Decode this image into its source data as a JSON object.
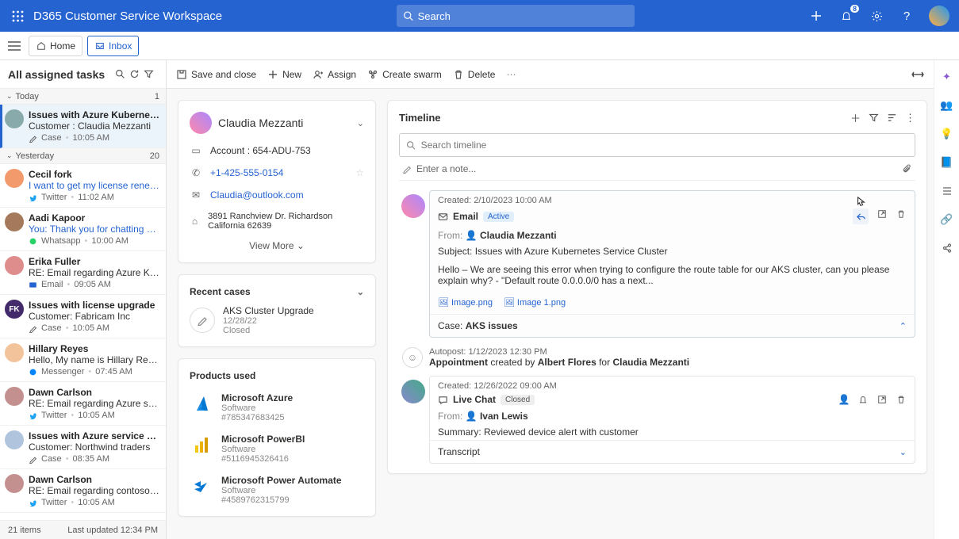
{
  "app_title": "D365 Customer Service Workspace",
  "search_placeholder": "Search",
  "notifications_count": "8",
  "tabs": {
    "home": "Home",
    "inbox": "Inbox"
  },
  "tasklist": {
    "title": "All assigned tasks",
    "groups": [
      {
        "label": "Today",
        "count": "1"
      },
      {
        "label": "Yesterday",
        "count": "20"
      }
    ],
    "items": [
      {
        "avatar_bg": "#8aa",
        "title": "Issues with Azure Kubernetes Service Cluster",
        "line": "Customer : Claudia Mezzanti",
        "channel": "Case",
        "channel_color": "#5c5c5c",
        "icon": "pencil",
        "time": "10:05 AM",
        "selected": true,
        "link": false
      },
      {
        "avatar_bg": "#f29a6b",
        "title": "Cecil fork",
        "line": "I want to get my license renewed by ...",
        "channel": "Twitter",
        "channel_color": "#1da1f2",
        "icon": "twitter",
        "time": "11:02 AM",
        "link": true
      },
      {
        "avatar_bg": "#a5795b",
        "title": "Aadi Kapoor",
        "line": "You: Thank you for chatting with mu...",
        "channel": "Whatsapp",
        "channel_color": "#25d366",
        "icon": "whatsapp",
        "time": "10:00 AM",
        "link": true
      },
      {
        "avatar_bg": "#de8c8c",
        "title": "Erika Fuller",
        "line": "RE: Email regarding Azure Kubernetes",
        "channel": "Email",
        "channel_color": "#2563d1",
        "icon": "email",
        "time": "09:05 AM",
        "link": false
      },
      {
        "avatar_bg": "#432a6b",
        "title": "Issues with license upgrade",
        "line": "Customer: Fabricam Inc",
        "channel": "Case",
        "channel_color": "#5c5c5c",
        "icon": "pencil",
        "time": "10:05 AM",
        "link": false,
        "initials": "FK"
      },
      {
        "avatar_bg": "#f3c49c",
        "title": "Hillary Reyes",
        "line": "Hello, My name is Hillary Reyes and...",
        "channel": "Messenger",
        "channel_color": "#0084ff",
        "icon": "messenger",
        "time": "07:45 AM",
        "link": false
      },
      {
        "avatar_bg": "#c48f8f",
        "title": "Dawn Carlson",
        "line": "RE: Email regarding Azure service errors",
        "channel": "Twitter",
        "channel_color": "#1da1f2",
        "icon": "twitter",
        "time": "10:05 AM",
        "link": false
      },
      {
        "avatar_bg": "#b0c4de",
        "title": "Issues with Azure service errors",
        "line": "Customer: Northwind traders",
        "channel": "Case",
        "channel_color": "#5c5c5c",
        "icon": "pencil",
        "time": "08:35 AM",
        "link": false
      },
      {
        "avatar_bg": "#c48f8f",
        "title": "Dawn Carlson",
        "line": "RE: Email regarding contoso machines",
        "channel": "Twitter",
        "channel_color": "#1da1f2",
        "icon": "twitter",
        "time": "10:05 AM",
        "link": false
      }
    ],
    "footer_items": "21 items",
    "footer_updated": "Last updated 12:34 PM"
  },
  "commands": {
    "save_close": "Save and close",
    "new": "New",
    "assign": "Assign",
    "swarm": "Create swarm",
    "delete": "Delete"
  },
  "customer": {
    "name": "Claudia Mezzanti",
    "account": "Account : 654-ADU-753",
    "phone": "+1-425-555-0154",
    "email": "Claudia@outlook.com",
    "address": "3891 Ranchview Dr. Richardson California 62639",
    "view_more": "View More"
  },
  "recent_cases": {
    "title": "Recent cases",
    "items": [
      {
        "title": "AKS Cluster Upgrade",
        "date": "12/28/22",
        "status": "Closed"
      }
    ]
  },
  "products": {
    "title": "Products used",
    "items": [
      {
        "name": "Microsoft Azure",
        "type": "Software",
        "serial": "#785347683425",
        "logo": "azure"
      },
      {
        "name": "Microsoft PowerBI",
        "type": "Software",
        "serial": "#5116945326416",
        "logo": "powerbi"
      },
      {
        "name": "Microsoft Power Automate",
        "type": "Software",
        "serial": "#4589762315799",
        "logo": "automate"
      }
    ]
  },
  "timeline": {
    "title": "Timeline",
    "search_ph": "Search timeline",
    "note_ph": "Enter a note...",
    "items": [
      {
        "created": "Created: 2/10/2023 10:00 AM",
        "type": "Email",
        "status": "Active",
        "from": "Claudia Mezzanti",
        "subject": "Subject: Issues with Azure Kubernetes Service Cluster",
        "body": "Hello – We are seeing this error when trying to configure the route table for our AKS cluster, can you please explain why? - \"Default route 0.0.0.0/0 has a next...",
        "attachments": [
          "Image.png",
          "Image 1.png"
        ],
        "footer": "Case: AKS issues",
        "hover": true
      },
      {
        "created": "Created: 12/26/2022 09:00 AM",
        "type": "Live Chat",
        "status": "Closed",
        "from": "Ivan Lewis",
        "summary": "Summary: Reviewed device alert with customer",
        "footer": "Transcript"
      }
    ],
    "autopost": {
      "meta": "Autopost: 1/12/2023 12:30 PM",
      "text1": "Appointment",
      "text2": "created by",
      "person1": "Albert Flores",
      "text3": "for",
      "person2": "Claudia Mezzanti"
    }
  }
}
